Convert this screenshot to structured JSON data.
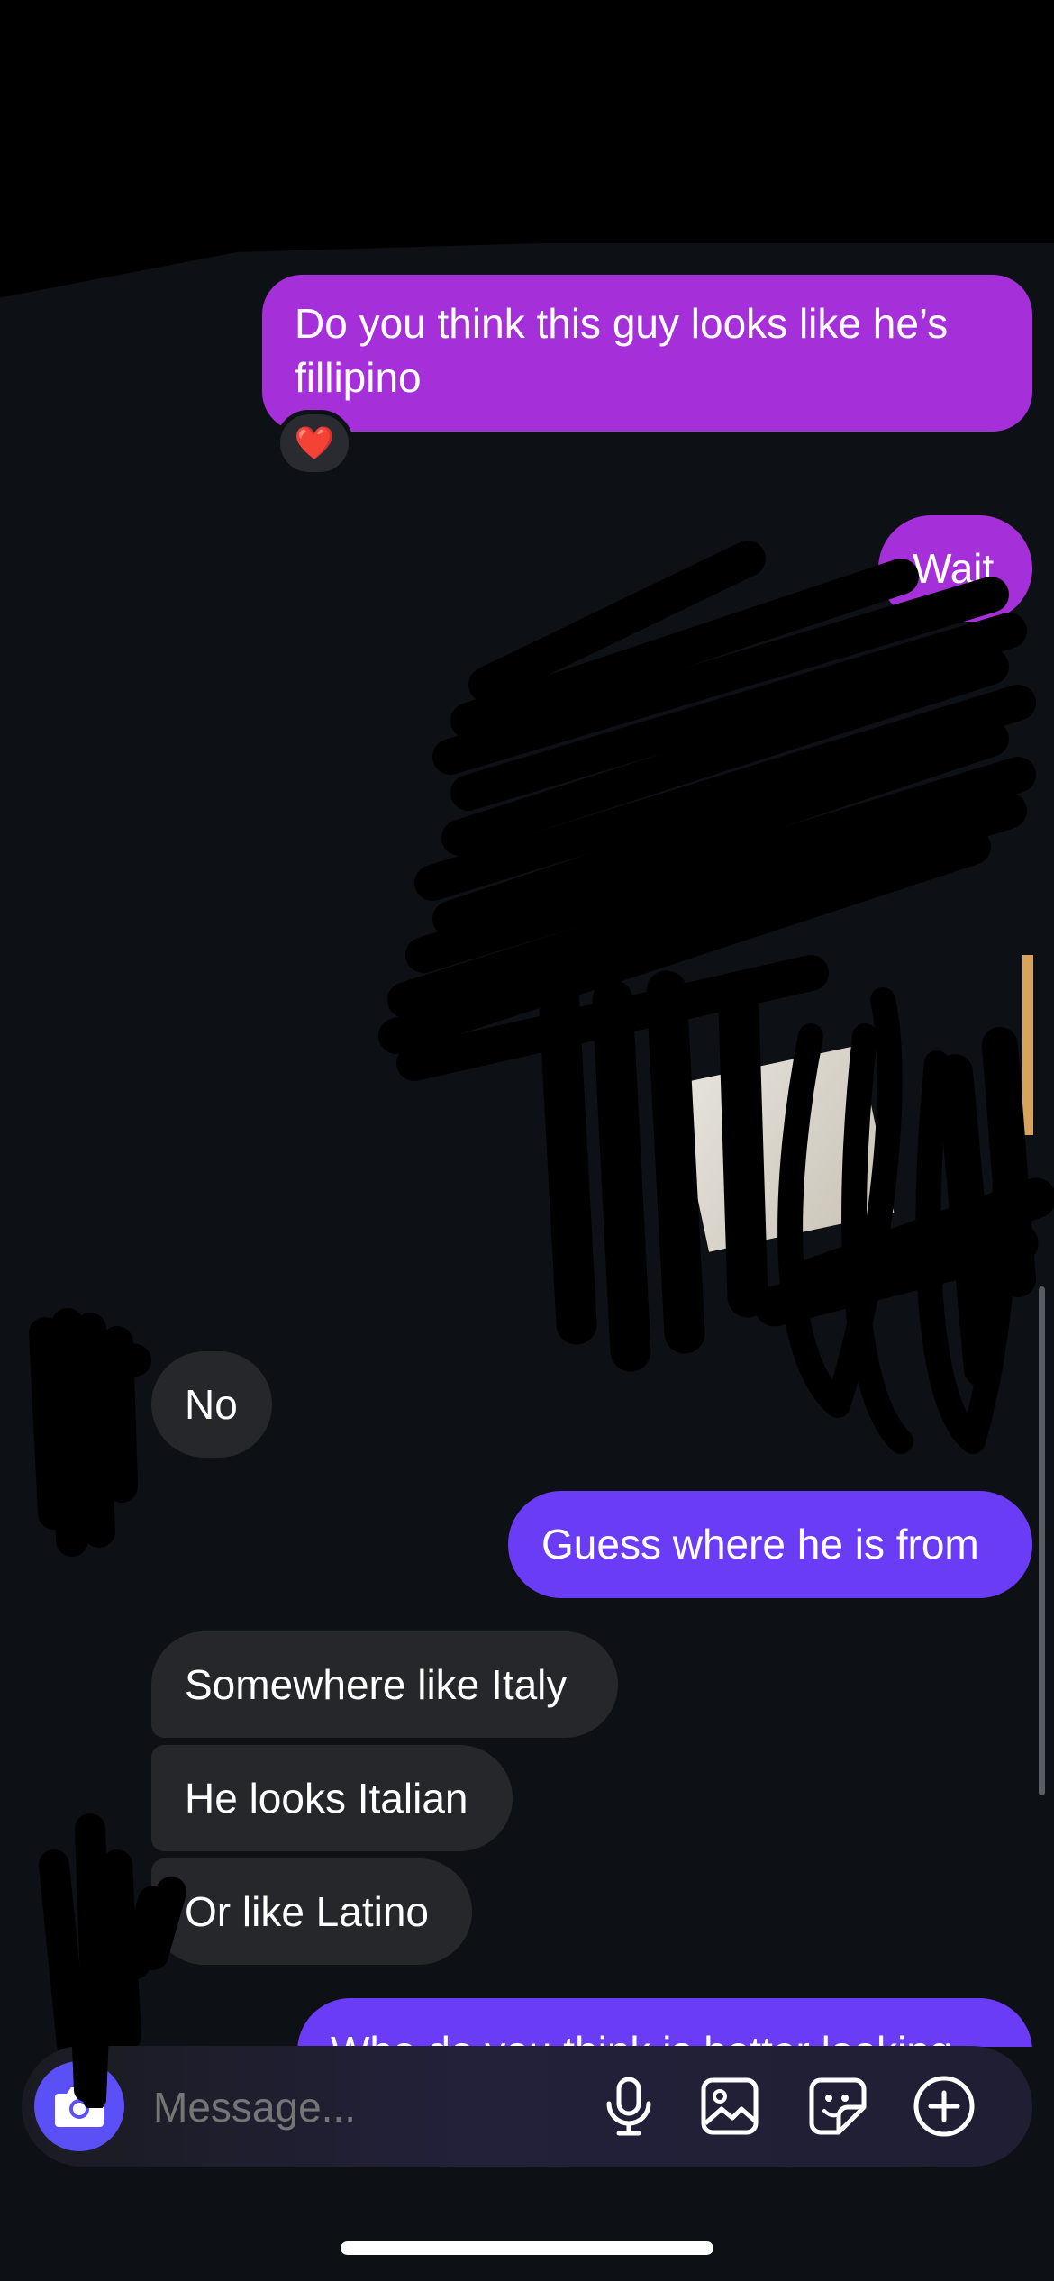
{
  "messages": {
    "m1": {
      "line1": "Do you think this guy looks like he’s",
      "line2": "fillipino",
      "reaction": "❤️"
    },
    "m2": "Wait",
    "m3": "No",
    "m4": "Guess where he is from",
    "m5": "Somewhere like Italy",
    "m6": "He looks Italian",
    "m7": "Or like Latino",
    "m8": "Who do you think is better looking"
  },
  "composer": {
    "placeholder": "Message...",
    "icons": [
      "camera-icon",
      "microphone-icon",
      "gallery-icon",
      "sticker-icon",
      "plus-icon"
    ]
  },
  "colors": {
    "background": "#0d1014",
    "outgoing_purple": "#a52fd8",
    "outgoing_violet": "#6a3cf6",
    "incoming": "#26272b",
    "camera_button": "#5b50f5"
  }
}
